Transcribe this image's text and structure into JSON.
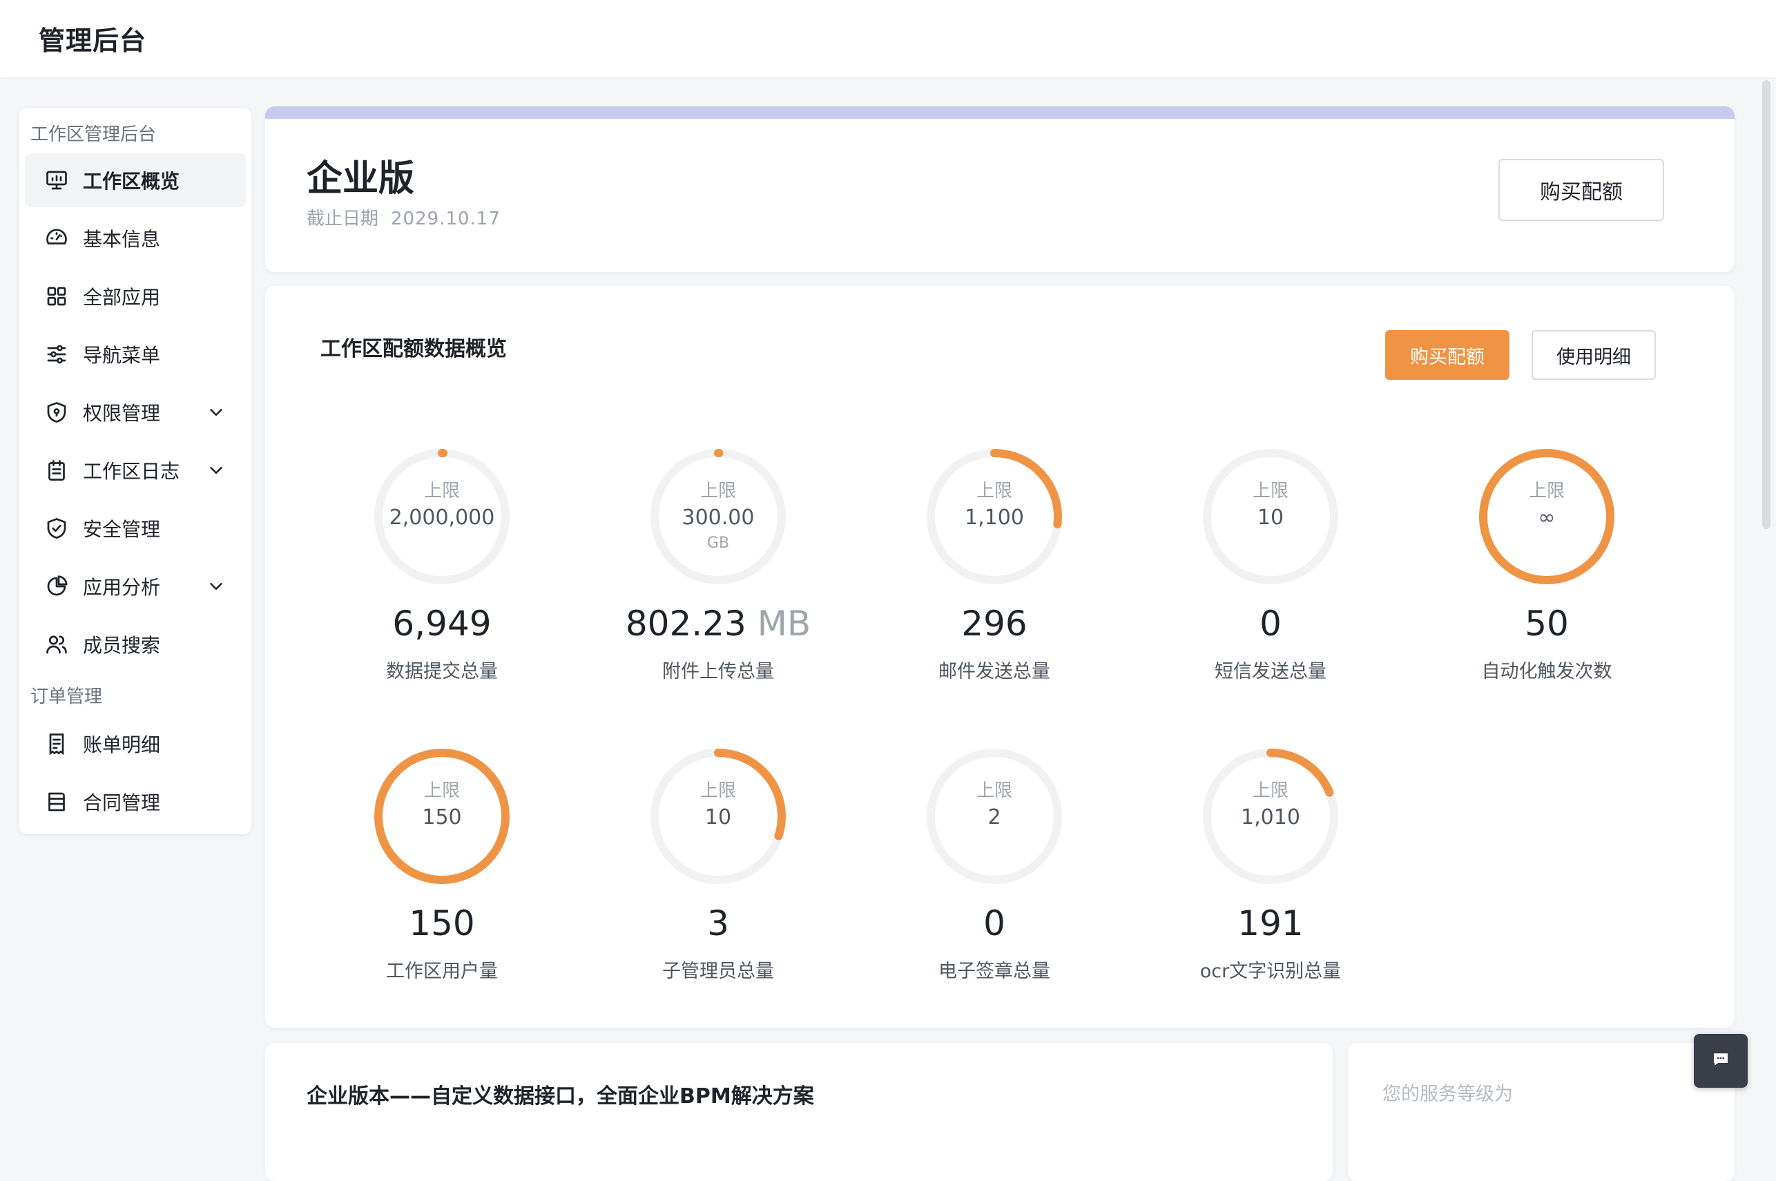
{
  "app": {
    "title": "管理后台"
  },
  "sidebar": {
    "sections": [
      {
        "label": "工作区管理后台"
      },
      {
        "label": "订单管理"
      }
    ],
    "items": [
      {
        "label": "工作区概览",
        "icon": "monitor-icon",
        "active": true
      },
      {
        "label": "基本信息",
        "icon": "dashboard-icon"
      },
      {
        "label": "全部应用",
        "icon": "grid-icon"
      },
      {
        "label": "导航菜单",
        "icon": "sliders-icon"
      },
      {
        "label": "权限管理",
        "icon": "shield-lock-icon",
        "expandable": true
      },
      {
        "label": "工作区日志",
        "icon": "calendar-icon",
        "expandable": true
      },
      {
        "label": "安全管理",
        "icon": "shield-check-icon"
      },
      {
        "label": "应用分析",
        "icon": "pie-chart-icon",
        "expandable": true
      },
      {
        "label": "成员搜索",
        "icon": "users-icon"
      },
      {
        "label": "账单明细",
        "icon": "receipt-icon"
      },
      {
        "label": "合同管理",
        "icon": "contract-icon"
      }
    ]
  },
  "plan": {
    "title": "企业版",
    "date_label": "截止日期",
    "date_value": "2029.10.17",
    "buy_button": "购买配额"
  },
  "quota": {
    "title": "工作区配额数据概览",
    "buy_button": "购买配额",
    "detail_button": "使用明细",
    "limit_label": "上限",
    "accent_color": "#ef9444",
    "track_color": "#f2f2f2",
    "metrics": [
      {
        "limit": "2,000,000",
        "value": "6,949",
        "label": "数据提交总量",
        "fraction": 0.0035
      },
      {
        "limit": "300.00",
        "limit_unit": "GB",
        "value": "802.23",
        "value_unit": "MB",
        "label": "附件上传总量",
        "fraction": 0.0026
      },
      {
        "limit": "1,100",
        "value": "296",
        "label": "邮件发送总量",
        "fraction": 0.269
      },
      {
        "limit": "10",
        "value": "0",
        "label": "短信发送总量",
        "fraction": 0
      },
      {
        "limit": "∞",
        "value": "50",
        "label": "自动化触发次数",
        "fraction": 1
      },
      {
        "limit": "150",
        "value": "150",
        "label": "工作区用户量",
        "fraction": 1
      },
      {
        "limit": "10",
        "value": "3",
        "label": "子管理员总量",
        "fraction": 0.3
      },
      {
        "limit": "2",
        "value": "0",
        "label": "电子签章总量",
        "fraction": 0
      },
      {
        "limit": "1,010",
        "value": "191",
        "label": "ocr文字识别总量",
        "fraction": 0.189
      }
    ]
  },
  "bottom": {
    "title": "企业版本——自定义数据接口，全面企业BPM解决方案",
    "service_label": "您的服务等级为"
  }
}
